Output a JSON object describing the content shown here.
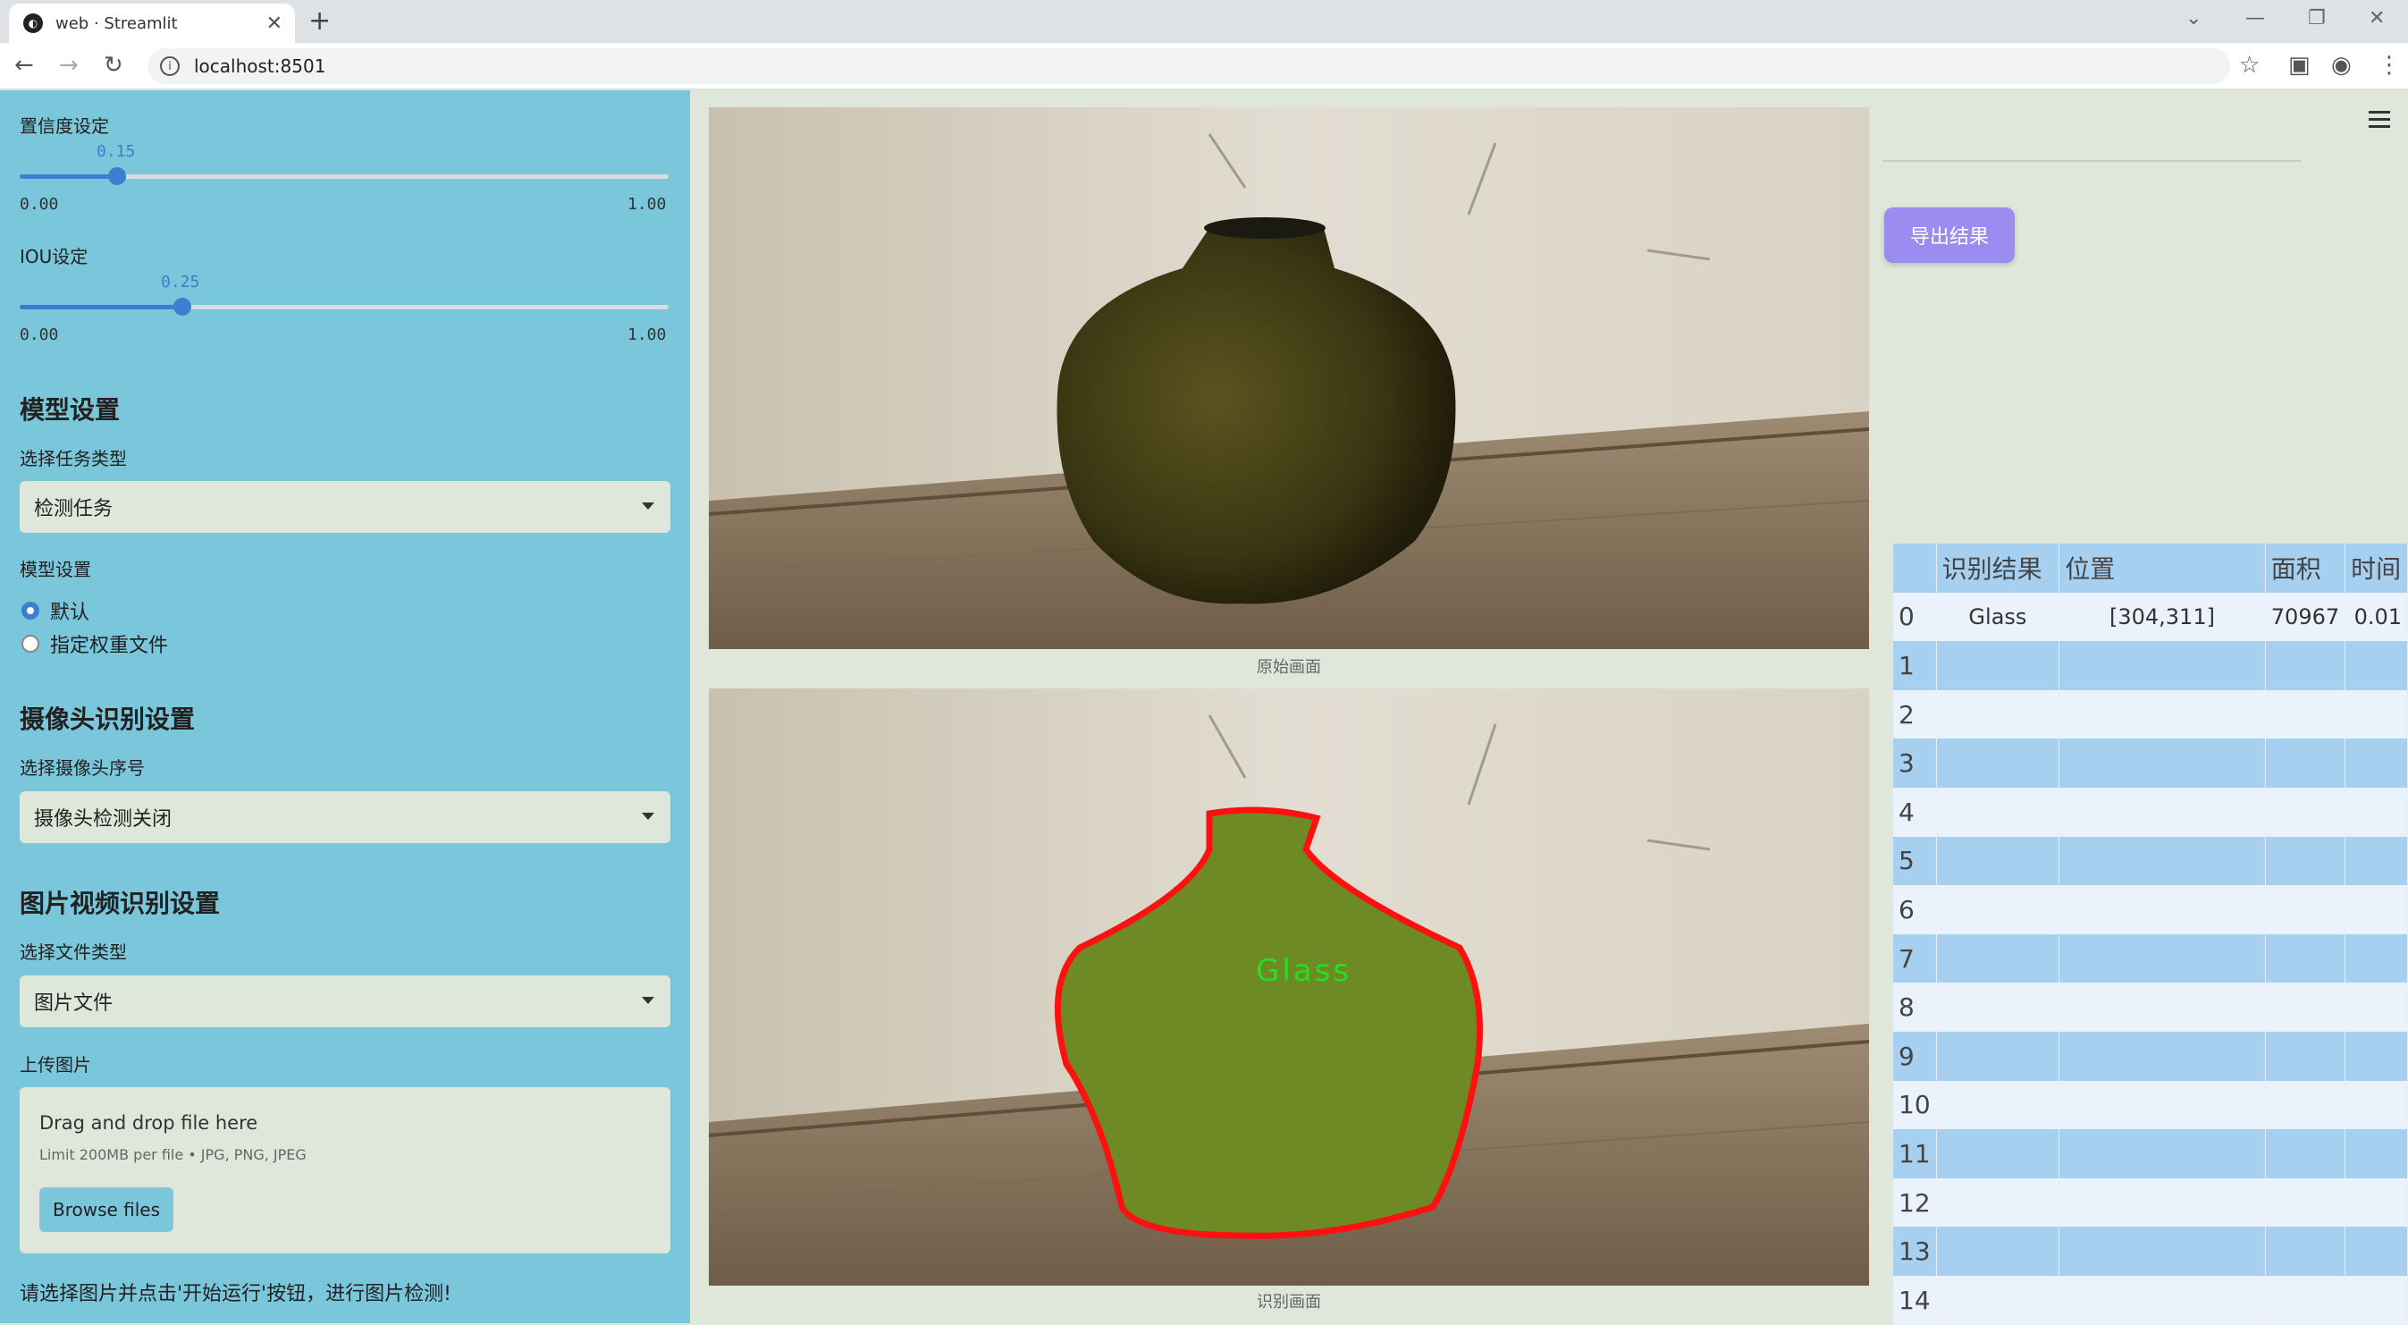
{
  "browser": {
    "tab_title": "web · Streamlit",
    "url": "localhost:8501"
  },
  "sidebar": {
    "confidence": {
      "label": "置信度设定",
      "value": "0.15",
      "min": "0.00",
      "max": "1.00",
      "fraction": 0.15
    },
    "iou": {
      "label": "IOU设定",
      "value": "0.25",
      "min": "0.00",
      "max": "1.00",
      "fraction": 0.25
    },
    "model_section": {
      "heading": "模型设置",
      "task_label": "选择任务类型",
      "task_value": "检测任务",
      "model_label": "模型设置",
      "options": [
        {
          "label": "默认",
          "selected": true
        },
        {
          "label": "指定权重文件",
          "selected": false
        }
      ]
    },
    "camera_section": {
      "heading": "摄像头识别设置",
      "camera_label": "选择摄像头序号",
      "camera_value": "摄像头检测关闭"
    },
    "media_section": {
      "heading": "图片视频识别设置",
      "filetype_label": "选择文件类型",
      "filetype_value": "图片文件",
      "upload_label": "上传图片",
      "drop_title": "Drag and drop file here",
      "drop_limit": "Limit 200MB per file • JPG, PNG, JPEG",
      "browse_label": "Browse files"
    },
    "hint": "请选择图片并点击'开始运行'按钮，进行图片检测!"
  },
  "main": {
    "original_caption": "原始画面",
    "result_caption": "识别画面",
    "detection_label": "Glass"
  },
  "right": {
    "export_label": "导出结果",
    "table": {
      "headers": [
        "",
        "识别结果",
        "位置",
        "面积",
        "时间"
      ],
      "rows": [
        {
          "idx": "0",
          "result": "Glass",
          "pos": "[304,311]",
          "area": "70967",
          "time": "0.01"
        },
        {
          "idx": "1",
          "result": "",
          "pos": "",
          "area": "",
          "time": ""
        },
        {
          "idx": "2",
          "result": "",
          "pos": "",
          "area": "",
          "time": ""
        },
        {
          "idx": "3",
          "result": "",
          "pos": "",
          "area": "",
          "time": ""
        },
        {
          "idx": "4",
          "result": "",
          "pos": "",
          "area": "",
          "time": ""
        },
        {
          "idx": "5",
          "result": "",
          "pos": "",
          "area": "",
          "time": ""
        },
        {
          "idx": "6",
          "result": "",
          "pos": "",
          "area": "",
          "time": ""
        },
        {
          "idx": "7",
          "result": "",
          "pos": "",
          "area": "",
          "time": ""
        },
        {
          "idx": "8",
          "result": "",
          "pos": "",
          "area": "",
          "time": ""
        },
        {
          "idx": "9",
          "result": "",
          "pos": "",
          "area": "",
          "time": ""
        },
        {
          "idx": "10",
          "result": "",
          "pos": "",
          "area": "",
          "time": ""
        },
        {
          "idx": "11",
          "result": "",
          "pos": "",
          "area": "",
          "time": ""
        },
        {
          "idx": "12",
          "result": "",
          "pos": "",
          "area": "",
          "time": ""
        },
        {
          "idx": "13",
          "result": "",
          "pos": "",
          "area": "",
          "time": ""
        },
        {
          "idx": "14",
          "result": "",
          "pos": "",
          "area": "",
          "time": ""
        }
      ]
    }
  },
  "colors": {
    "sidebar_bg": "#7ac6da",
    "accent": "#3b7fd1",
    "export_button": "#9b8cf2",
    "detection_outline": "#ff1010",
    "detection_label": "#22e022"
  }
}
